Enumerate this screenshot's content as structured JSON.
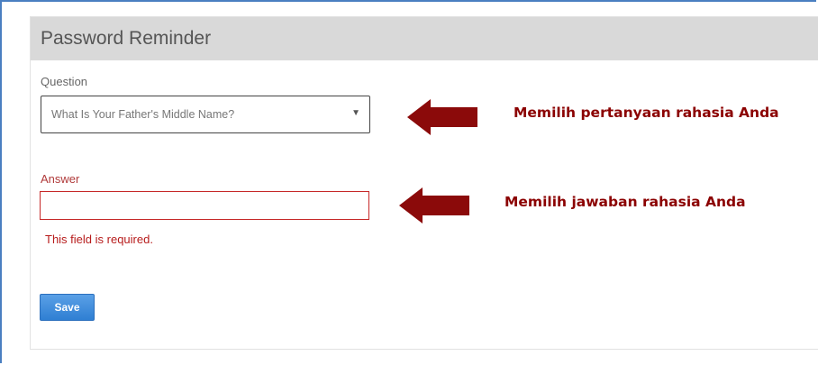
{
  "panel": {
    "title": "Password Reminder"
  },
  "question": {
    "label": "Question",
    "selected_value": "What Is Your Father's Middle Name?",
    "caret_glyph": "▼"
  },
  "answer": {
    "label": "Answer",
    "value": "",
    "error": "This field is required."
  },
  "save_button": {
    "label": "Save"
  },
  "annotations": {
    "question_note": "Memilih pertanyaan rahasia Anda",
    "answer_note": "Memilih jawaban rahasia Anda"
  },
  "colors": {
    "annotation": "#8b0000",
    "error": "#c62828",
    "save_button": "#3d8ad9",
    "header_bg": "#d9d9d9"
  }
}
